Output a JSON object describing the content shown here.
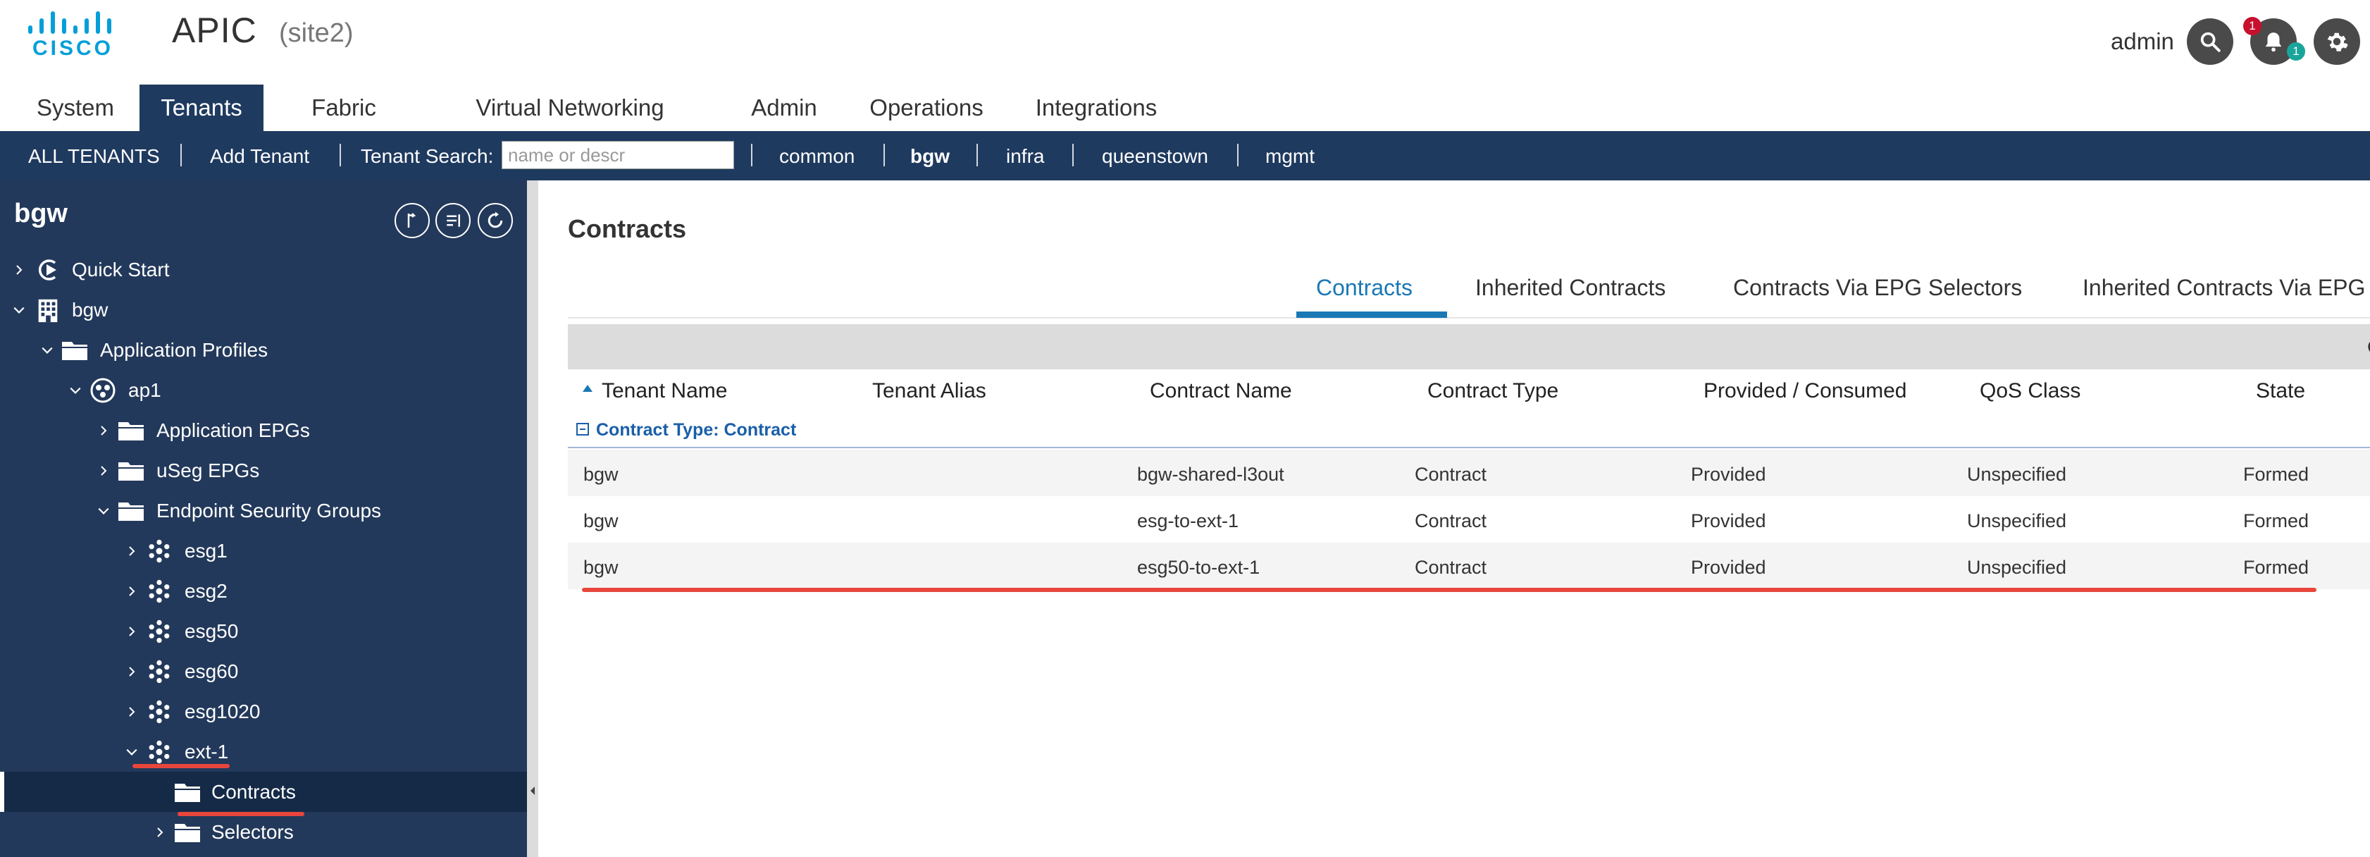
{
  "header": {
    "logo_text": "CISCO",
    "app_title": "APIC",
    "site": "(site2)",
    "user": "admin",
    "alerts_count": "1",
    "notifications_count": "1"
  },
  "top_tabs": [
    {
      "label": "System"
    },
    {
      "label": "Tenants"
    },
    {
      "label": "Fabric"
    },
    {
      "label": "Virtual Networking"
    },
    {
      "label": "Admin"
    },
    {
      "label": "Operations"
    },
    {
      "label": "Integrations"
    }
  ],
  "subnav": {
    "all_tenants": "ALL TENANTS",
    "add_tenant": "Add Tenant",
    "search_label": "Tenant Search:",
    "search_placeholder": "name or descr",
    "tenants": [
      "common",
      "bgw",
      "infra",
      "queenstown",
      "mgmt"
    ]
  },
  "tree": {
    "title": "bgw",
    "items": [
      {
        "label": "Quick Start"
      },
      {
        "label": "bgw"
      },
      {
        "label": "Application Profiles"
      },
      {
        "label": "ap1"
      },
      {
        "label": "Application EPGs"
      },
      {
        "label": "uSeg EPGs"
      },
      {
        "label": "Endpoint Security Groups"
      },
      {
        "label": "esg1"
      },
      {
        "label": "esg2"
      },
      {
        "label": "esg50"
      },
      {
        "label": "esg60"
      },
      {
        "label": "esg1020"
      },
      {
        "label": "ext-1"
      },
      {
        "label": "Contracts"
      },
      {
        "label": "Selectors"
      }
    ]
  },
  "content": {
    "title": "Contracts",
    "tabs": [
      {
        "label": "Contracts"
      },
      {
        "label": "Inherited Contracts"
      },
      {
        "label": "Contracts Via EPG Selectors"
      },
      {
        "label": "Inherited Contracts Via EPG"
      }
    ],
    "columns": [
      "Tenant Name",
      "Tenant Alias",
      "Contract Name",
      "Contract Type",
      "Provided / Consumed",
      "QoS Class",
      "State"
    ],
    "group_label": "Contract Type: Contract",
    "rows": [
      {
        "tenant": "bgw",
        "alias": "",
        "contract": "bgw-shared-l3out",
        "type": "Contract",
        "pc": "Provided",
        "qos": "Unspecified",
        "state": "Formed"
      },
      {
        "tenant": "bgw",
        "alias": "",
        "contract": "esg-to-ext-1",
        "type": "Contract",
        "pc": "Provided",
        "qos": "Unspecified",
        "state": "Formed"
      },
      {
        "tenant": "bgw",
        "alias": "",
        "contract": "esg50-to-ext-1",
        "type": "Contract",
        "pc": "Provided",
        "qos": "Unspecified",
        "state": "Formed"
      }
    ]
  },
  "colors": {
    "nav_dark": "#1f3a5f",
    "tree_bg": "#23395b",
    "accent": "#1a78b4",
    "highlight": "#e8463c"
  }
}
